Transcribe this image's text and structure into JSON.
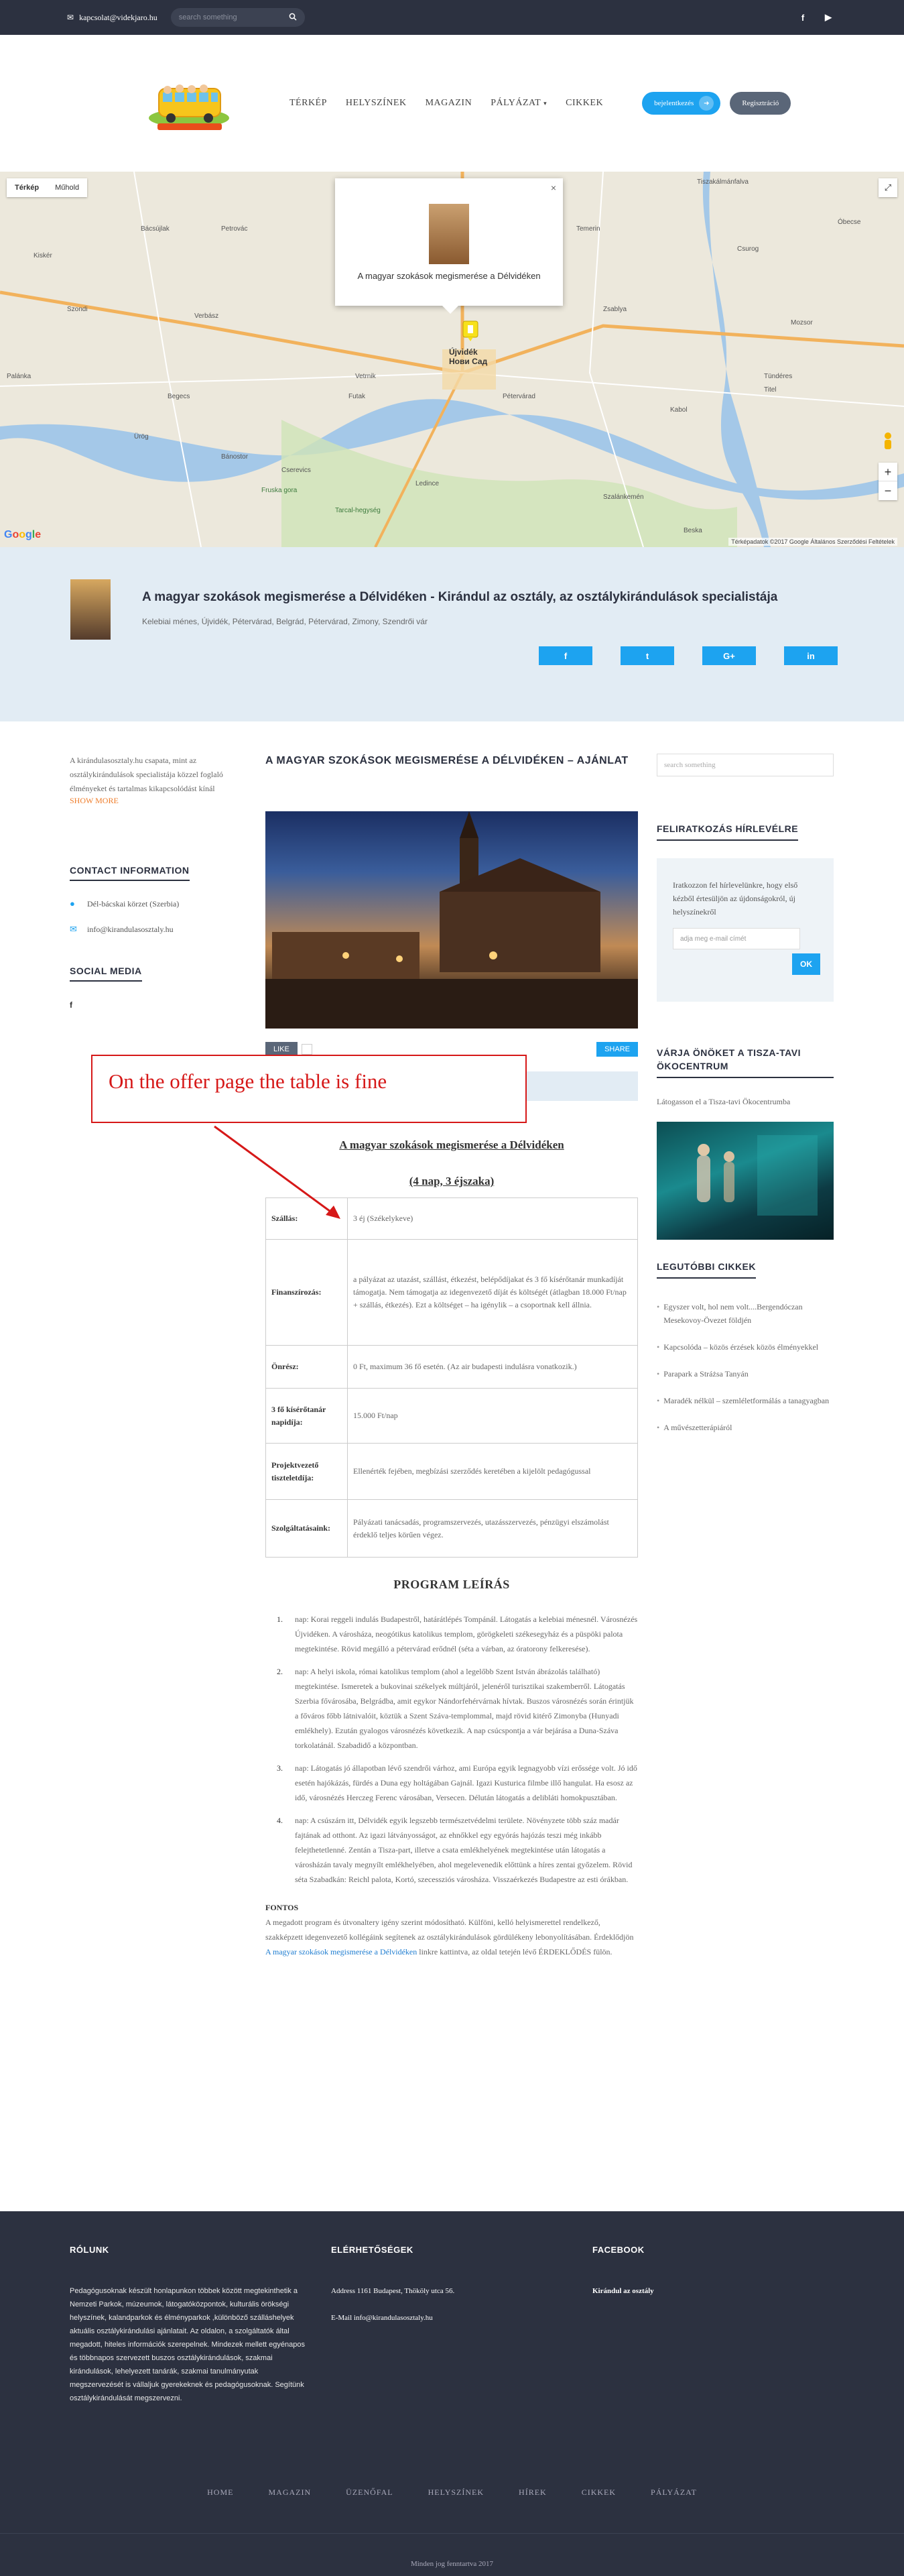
{
  "topbar": {
    "email": "kapcsolat@videkjaro.hu",
    "search_placeholder": "search something",
    "social": [
      "f",
      "▶"
    ]
  },
  "nav": {
    "items": [
      "TÉRKÉP",
      "HELYSZÍNEK",
      "MAGAZIN",
      "PÁLYÁZAT",
      "CIKKEK"
    ],
    "login_label": "bejelentkezés",
    "register_label": "Regisztráció"
  },
  "map": {
    "type_map": "Térkép",
    "type_satellite": "Műhold",
    "popup_title": "A magyar szokások megismerése a Délvidéken",
    "terms": "Térképadatok ©2017 Google   Általános Szerződési Feltételek",
    "labels": [
      "Újvidék",
      "Нови Сад",
      "Petrovác",
      "Pétervárad",
      "Kiskér",
      "Kiskér",
      "Bácsújlak",
      "Temerin",
      "Titel",
      "Tiszakálmánfalva",
      "Begecs",
      "Verbász",
      "Szondi",
      "Kabol",
      "Zsablya",
      "Csurog",
      "Óbecse",
      "Mozsor",
      "Tündéres",
      "Vetrnik",
      "Futak",
      "Palánka",
      "Ürög",
      "Bánostor",
      "Cserevics",
      "Ledince",
      "Szalánkemén",
      "Beska",
      "Fruska gora",
      "Tarcal-hegység"
    ]
  },
  "band": {
    "title": "A magyar szokások megismerése a Délvidéken - Kirándul az osztály, az osztálykirándulások specialistája",
    "subtitle": "Kelebiai ménes, Újvidék, Pétervárad, Belgrád, Pétervárad, Zimony, Szendrői vár",
    "shares": [
      "f",
      "t",
      "G+",
      "in"
    ]
  },
  "left": {
    "intro": "A kirándulasosztaly.hu csapata, mint az osztálykirándulások specialistája közzel foglaló élményeket és tartalmas kikapcsolódást kínál",
    "more": "SHOW MORE",
    "contact_title": "CONTACT INFORMATION",
    "address": "Dél-bácskai körzet (Szerbia)",
    "email": "info@kirandulasosztaly.hu",
    "social_title": "SOCIAL MEDIA",
    "social_icon": "f"
  },
  "center": {
    "title": "A MAGYAR SZOKÁSOK MEGISMERÉSE A DÉLVIDÉKEN – AJÁNLAT",
    "like": "LIKE",
    "share": "SHARE",
    "annotation": "On the offer page the table is fine",
    "offer_title": "A magyar szokások megismerése a Délvidéken",
    "offer_sub": "(4 nap, 3 éjszaka)",
    "table": [
      {
        "k": "Szállás:",
        "v": "3 éj (Székelykeve)"
      },
      {
        "k": "Finanszírozás:",
        "v": "a pályázat az utazást, szállást, étkezést, belépődíjakat és 3 fő kísérőtanár munkadíját támogatja. Nem támogatja az idegenvezető díját és költségét (átlagban 18.000 Ft/nap + szállás, étkezés). Ezt a költséget – ha igénylik – a csoportnak kell állnia."
      },
      {
        "k": "Önrész:",
        "v": "0 Ft, maximum 36 fő esetén.   (Az air budapesti indulásra vonatkozik.)"
      },
      {
        "k": "3 fő kísérőtanár napidíja:",
        "v": "15.000 Ft/nap"
      },
      {
        "k": "Projektvezető tiszteletdíja:",
        "v": "Ellenérték fejében, megbízási szerződés keretében a kijelölt pedagógussal"
      },
      {
        "k": "Szolgáltatásaink:",
        "v": "Pályázati tanácsadás, programszervezés, utazásszervezés, pénzügyi elszámolást érdeklő teljes körűen végez."
      }
    ],
    "program_title": "PROGRAM LEÍRÁS",
    "days": [
      {
        "n": "1.",
        "t": "nap: Korai reggeli indulás Budapestről, határátlépés Tompánál. Látogatás a kelebiai ménesnél. Városnézés Újvidéken. A városháza, neogótikus katolikus templom, görögkeleti székesegyház és a püspöki palota megtekintése. Rövid megálló a pétervárad erődnél (séta a várban, az óratorony felkeresése)."
      },
      {
        "n": "2.",
        "t": "nap: A helyi iskola, római katolikus templom (ahol a legelőbb Szent István ábrázolás található) megtekintése. Ismeretek a bukovinai székelyek múltjáról, jelenéről turisztikai szakemberről. Látogatás Szerbia fővárosába, Belgrádba, amit egykor Nándorfehérvárnak hívtak. Buszos városnézés során érintjük a főváros főbb látnivalóit, köztük a Szent Száva-templommal, majd rövid kitérő Zimonyba (Hunyadi emlékhely). Ezután gyalogos városnézés következik. A nap csúcspontja a vár bejárása a Duna-Száva torkolatánál. Szabadidő a központban."
      },
      {
        "n": "3.",
        "t": "nap: Látogatás jó állapotban lévő szendrői várhoz, ami Európa egyik legnagyobb vízi erőssége volt. Jó idő esetén hajókázás, fürdés a Duna egy holtágában Gajnál. Igazi Kusturica filmbe illő hangulat. Ha esosz az idő, városnézés Herczeg Ferenc városában, Versecen. Délután látogatás a delibláti homokpusztában."
      },
      {
        "n": "4.",
        "t": "nap: A csúszárn itt, Délvidék egyik legszebb természetvédelmi területe. Növényzete több száz madár fajtának ad otthont. Az igazi látványosságot, az ehnőkkel egy egyórás hajózás teszi még inkább felejthetetlenné. Zentán a Tisza-part, illetve a csata emlékhelyének megtekintése után látogatás a városházán tavaly megnyílt emlékhelyében, ahol megelevenedik előttünk a híres zentai győzelem. Rövid séta Szabadkán: Reichl palota, Kortó, szecessziós városháza. Visszaérkezés Budapestre az esti órákban."
      }
    ],
    "fontos_title": "FONTOS",
    "fontos_text_a": "A megadott program és útvonaltery igény szerint módosítható. Külföni,  kelló helyismerettel rendelkező, szakképzett idegenvezető kollégáink segítenek  az osztálykirándulások gördülékeny lebonyolításában. Érdeklődjön ",
    "fontos_link": "A magyar szokások megismerése a Délvidéken",
    "fontos_text_b": " linkre kattintva, az oldal tetején lévő ÉRDEKLŐDÉS fülön."
  },
  "right": {
    "search_placeholder": "search something",
    "newsletter_title": "FELIRATKOZÁS HÍRLEVÉLRE",
    "newsletter_text": "Iratkozzon fel hírlevelünkre, hogy első kézből értesüljön az újdonságokról, új helyszínekről",
    "email_placeholder": "adja meg e-mail címét",
    "ok": "OK",
    "tisza_title": "VÁRJA ÖNÖKET A TISZA-TAVI ÖKOCENTRUM",
    "tisza_text": "Látogasson el a Tisza-tavi Ökocentrumba",
    "recent_title": "LEGUTÓBBI CIKKEK",
    "recent": [
      "Egyszer volt, hol nem volt....Bergendóczan Mesekovoy-Övezet földjén",
      "Kapcsolódа – közös érzések közös élményekkel",
      "Parapark a Stráżsa Tanyán",
      "Maradék nélkül – szemléletformálás a tanagyagban",
      "A művészetterápiáról"
    ]
  },
  "footer": {
    "about_title": "RÓLUNK",
    "about_text": "Pedagógusoknak készült honlapunkon többek között megtekinthetik a Nemzeti Parkok, múzeumok, látogatóközpontok, kulturális örökségi helyszínek, kalandparkok és élményparkok ,különböző szálláshelyek aktuális osztálykirándulási ajánlatait. Az oldalon, a szolgáltatók által megadott, hiteles információk szerepelnek. Mindezek mellett egyénapos és többnapos szervezett buszos osztálykirándulások, szakmai kirándulások, lehelyezett tanárák, szakmai tanulmányutak megszervezését is vállaljuk gyerekeknek és pedagógusoknak. Segítünk osztálykirándulását megszervezni.",
    "contact_title": "ELÉRHETŐSÉGEK",
    "address": "Address  1161 Budapest, Thököly utca 56.",
    "email": "E-Mail   info@kirandulasosztaly.hu",
    "facebook_title": "FACEBOOK",
    "facebook_link": "Kirándul az osztály",
    "nav": [
      "HOME",
      "MAGAZIN",
      "ÜZENŐFAL",
      "HELYSZÍNEK",
      "HÍREK",
      "CIKKEK",
      "PÁLYÁZAT"
    ],
    "copyright": "Minden jog fenntartva 2017"
  },
  "colors": {
    "accent": "#1da3f0",
    "dark": "#2c3140",
    "band": "#e2ecf4",
    "annotation": "#d61818"
  }
}
